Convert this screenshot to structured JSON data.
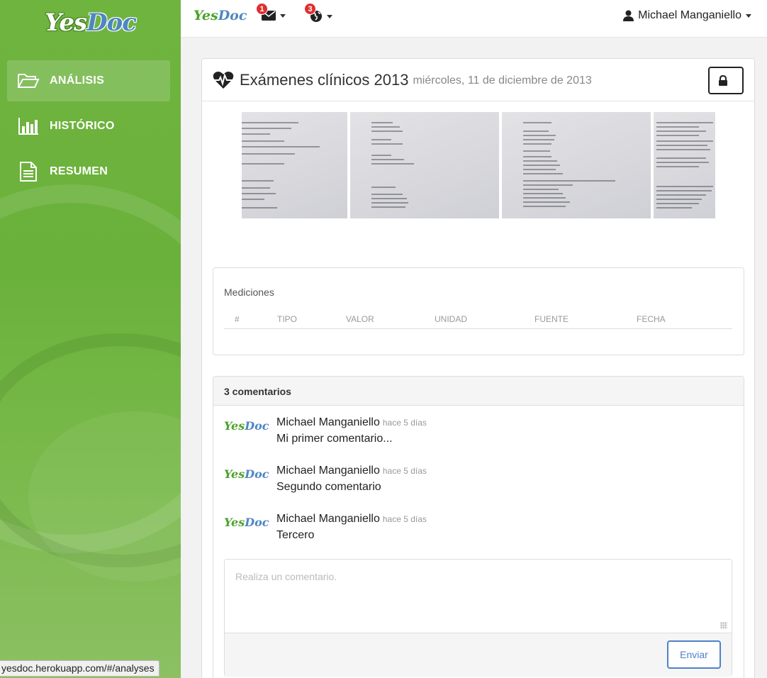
{
  "sidebar": {
    "logo_yes": "Yes",
    "logo_doc": "Doc",
    "items": [
      {
        "label": "ANÁLISIS",
        "icon": "folder-open-icon"
      },
      {
        "label": "HISTÓRICO",
        "icon": "bar-chart-icon"
      },
      {
        "label": "RESUMEN",
        "icon": "document-icon"
      }
    ]
  },
  "status_url": "yesdoc.herokuapp.com/#/analyses",
  "topbar": {
    "logo_yes": "Yes",
    "logo_doc": "Doc",
    "messages_badge": "1",
    "notifications_badge": "3",
    "user_name": "Michael Manganiello"
  },
  "analysis": {
    "title": "Exámenes clínicos 2013",
    "date": "miércoles, 11 de diciembre de 2013"
  },
  "mediciones": {
    "title": "Mediciones",
    "columns": [
      "#",
      "TIPO",
      "VALOR",
      "UNIDAD",
      "FUENTE",
      "FECHA"
    ]
  },
  "comments": {
    "header": "3 comentarios",
    "logo_yes": "Yes",
    "logo_doc": "Doc",
    "items": [
      {
        "author": "Michael Manganiello",
        "time": "hace 5 días",
        "text": "Mi primer comentario..."
      },
      {
        "author": "Michael Manganiello",
        "time": "hace 5 días",
        "text": "Segundo comentario"
      },
      {
        "author": "Michael Manganiello",
        "time": "hace 5 días",
        "text": "Tercero"
      }
    ],
    "placeholder": "Realiza un comentario.",
    "send_label": "Enviar"
  },
  "colors": {
    "sidebar_green": "#6ab13b",
    "brand_blue": "#4e86c2",
    "badge_red": "#e02f2f",
    "send_blue": "#4f82c7"
  }
}
